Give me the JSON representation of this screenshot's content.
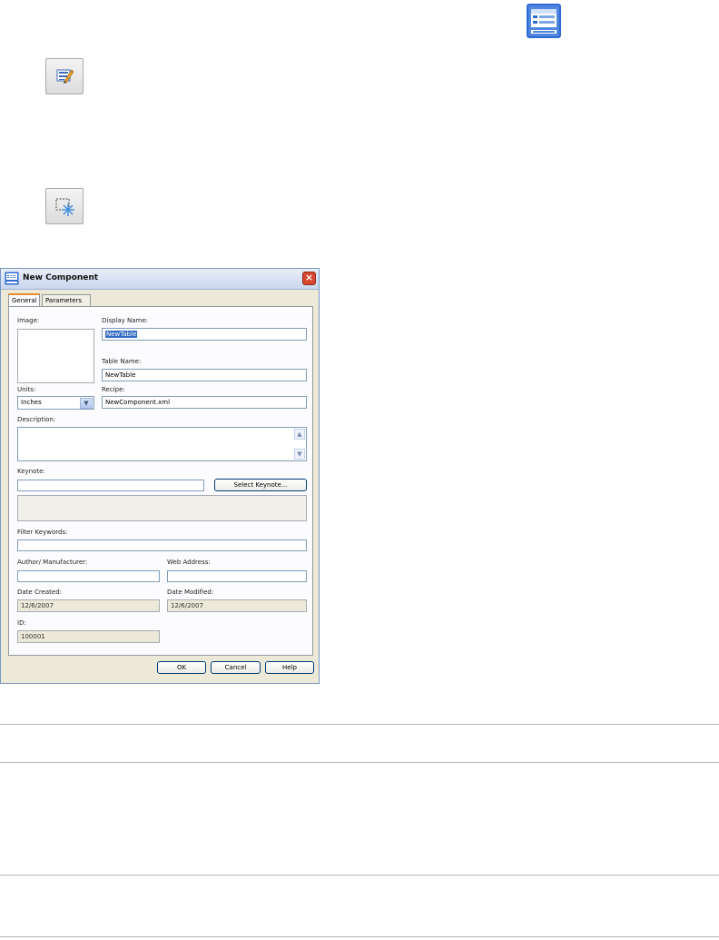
{
  "icons": {
    "toolbar_table": "table-icon",
    "edit": "edit-properties-icon",
    "select": "select-objects-icon"
  },
  "dialog": {
    "title": "New Component",
    "tabs": [
      "General",
      "Parameters"
    ],
    "labels": {
      "image": "Image:",
      "display_name": "Display Name:",
      "table_name": "Table Name:",
      "units": "Units:",
      "recipe": "Recipe:",
      "description": "Description:",
      "keynote": "Keynote:",
      "filter_keywords": "Filter Keywords:",
      "author": "Author/ Manufacturer:",
      "web_address": "Web Address:",
      "date_created": "Date Created:",
      "date_modified": "Date Modified:",
      "id": "ID:"
    },
    "values": {
      "display_name": "NewTable",
      "table_name": "NewTable",
      "units": "Inches",
      "recipe": "NewComponent.xml",
      "description": "",
      "keynote": "",
      "filter_keywords": "",
      "author": "",
      "web_address": "",
      "date_created": "12/6/2007",
      "date_modified": "12/6/2007",
      "id": "100001"
    },
    "buttons": {
      "select_keynote": "Select Keynote...",
      "ok": "OK",
      "cancel": "Cancel",
      "help": "Help"
    }
  }
}
